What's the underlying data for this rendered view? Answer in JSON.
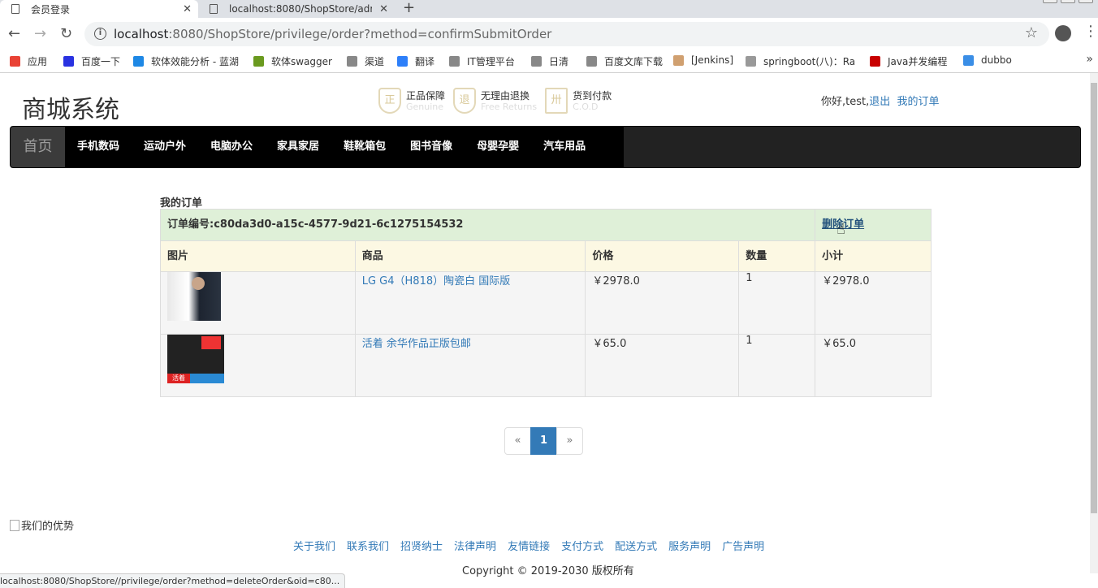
{
  "browser": {
    "tabs": [
      {
        "title": "会员登录",
        "active": true
      },
      {
        "title": "localhost:8080/ShopStore/adm",
        "active": false
      }
    ],
    "url_host": "localhost",
    "url_rest": ":8080/ShopStore/privilege/order?method=confirmSubmitOrder",
    "bookmarks": [
      {
        "label": "应用",
        "icon": "apps-grid-icon",
        "color": "#e94235"
      },
      {
        "label": "百度一下",
        "icon": "baidu-paw-icon",
        "color": "#2932e1"
      },
      {
        "label": "软体效能分析 - 蓝湖",
        "icon": "lanhu-icon",
        "color": "#1e88e5"
      },
      {
        "label": "软体swagger",
        "icon": "swagger-icon",
        "color": "#6a9a1f"
      },
      {
        "label": "渠道",
        "icon": "page-icon",
        "color": "#888888"
      },
      {
        "label": "翻译",
        "icon": "translate-icon",
        "color": "#2d7ff9"
      },
      {
        "label": "IT管理平台",
        "icon": "page-icon",
        "color": "#888888"
      },
      {
        "label": "日清",
        "icon": "page-icon",
        "color": "#888888"
      },
      {
        "label": "百度文库下载",
        "icon": "page-icon",
        "color": "#888888"
      },
      {
        "label": "[Jenkins]",
        "icon": "jenkins-icon",
        "color": "#d0a070"
      },
      {
        "label": "springboot(八)：Ra",
        "icon": "blog-icon",
        "color": "#999999"
      },
      {
        "label": "Java并发编程",
        "icon": "csdn-icon",
        "color": "#c80000"
      },
      {
        "label": "dubbo",
        "icon": "dubbo-icon",
        "color": "#3a8ee6"
      }
    ],
    "status_url": "localhost:8080/ShopStore//privilege/order?method=deleteOrder&oid=c80..."
  },
  "header": {
    "logo": "商城系统",
    "badges": [
      {
        "title": "正品保障",
        "subtitle": "Genuine",
        "glyph": "正"
      },
      {
        "title": "无理由退换",
        "subtitle": "Free Returns",
        "glyph": "退"
      },
      {
        "title": "货到付款",
        "subtitle": "C.O.D",
        "glyph": "卅"
      }
    ],
    "greeting": "你好,test,",
    "logout": "退出",
    "my_orders": "我的订单"
  },
  "nav": {
    "home": "首页",
    "categories": [
      "手机数码",
      "运动户外",
      "电脑办公",
      "家具家居",
      "鞋靴箱包",
      "图书音像",
      "母婴孕婴",
      "汽车用品"
    ]
  },
  "orders": {
    "section_title": "我的订单",
    "order_no_label": "订单编号:c80da3d0-a15c-4577-9d21-6c1275154532",
    "delete_label": "删除订单",
    "columns": [
      "图片",
      "商品",
      "价格",
      "数量",
      "小计"
    ],
    "items": [
      {
        "name": "LG G4（H818）陶瓷白 国际版",
        "price": "￥2978.0",
        "qty": "1",
        "subtotal": "￥2978.0"
      },
      {
        "name": "活着 余华作品正版包邮",
        "price": "￥65.0",
        "qty": "1",
        "subtotal": "￥65.0"
      }
    ]
  },
  "pager": {
    "prev": "«",
    "current": "1",
    "next": "»"
  },
  "footer": {
    "advantage_alt": "我们的优势",
    "links": [
      "关于我们",
      "联系我们",
      "招贤纳士",
      "法律声明",
      "友情链接",
      "支付方式",
      "配送方式",
      "服务声明",
      "广告声明"
    ],
    "copyright": "Copyright © 2019-2030 版权所有"
  },
  "book_thumb_text": "活着"
}
